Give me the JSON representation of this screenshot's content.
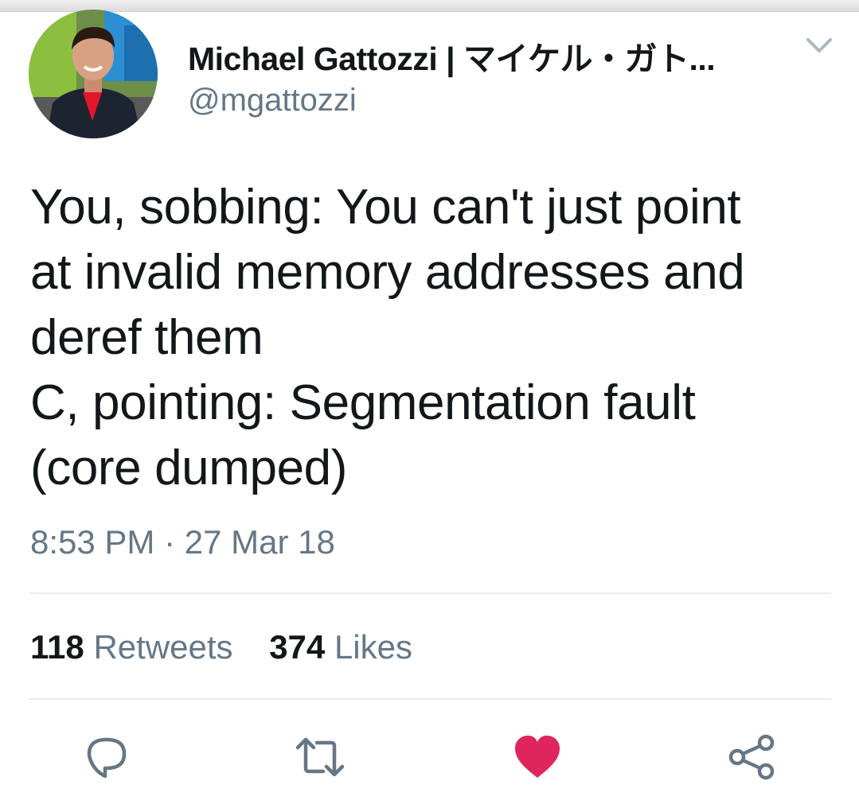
{
  "tweet": {
    "author": {
      "display_name": "Michael Gattozzi | マイケル・ガト...",
      "handle": "@mgattozzi"
    },
    "text_lines": [
      "You, sobbing: You can't just point",
      "at invalid memory addresses and",
      "deref them",
      "C, pointing: Segmentation fault",
      "(core dumped)"
    ],
    "timestamp": "8:53 PM · 27 Mar 18",
    "stats": {
      "retweets_count": "118",
      "retweets_label": "Retweets",
      "likes_count": "374",
      "likes_label": "Likes"
    }
  },
  "actions": {
    "reply_icon": "reply-icon",
    "retweet_icon": "retweet-icon",
    "like_icon": "heart-icon",
    "share_icon": "share-icon"
  },
  "colors": {
    "text": "#14171a",
    "secondary": "#657786",
    "like": "#e0245e",
    "divider": "#e6ecf0"
  }
}
